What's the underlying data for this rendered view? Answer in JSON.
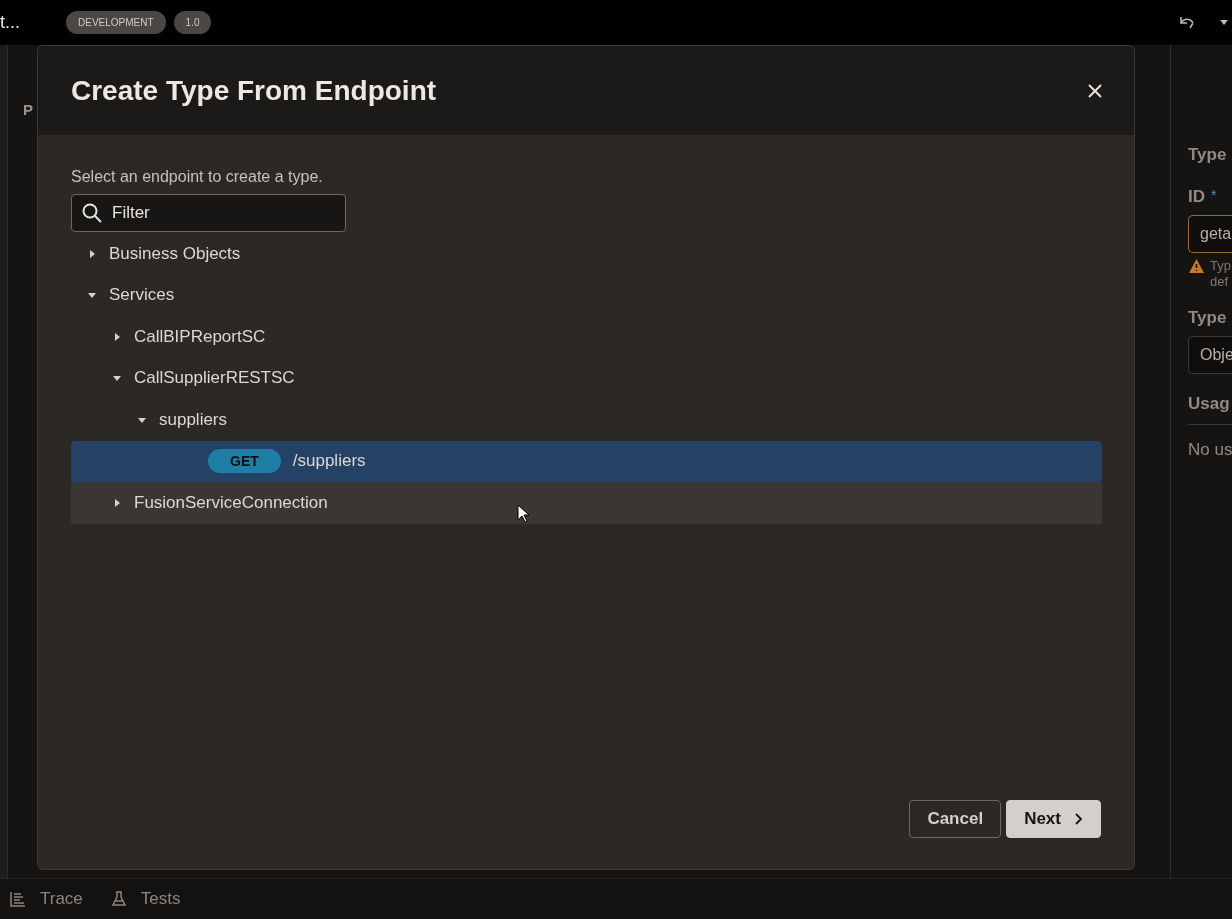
{
  "header": {
    "title": "t...",
    "badges": [
      "DEVELOPMENT",
      "1.0"
    ]
  },
  "left_panel": {
    "heading": "P"
  },
  "right_panel": {
    "heading": "Type",
    "id_label": "ID",
    "required_mark": "*",
    "id_value": "geta",
    "warning_lines": [
      "Typ",
      "def"
    ],
    "type_label": "Type",
    "type_value": "Obje",
    "usages_label": "Usag",
    "usages_text": "No us"
  },
  "dialog": {
    "title": "Create Type From Endpoint",
    "instruction": "Select an endpoint to create a type.",
    "filter": {
      "placeholder": "Filter"
    },
    "tree": [
      {
        "kind": "folder",
        "label": "Business Objects",
        "expanded": false,
        "selected": false,
        "hovered": false
      },
      {
        "kind": "folder",
        "label": "Services",
        "expanded": true,
        "selected": false,
        "hovered": false,
        "children": [
          {
            "kind": "folder",
            "label": "CallBIPReportSC",
            "expanded": false,
            "selected": false,
            "hovered": false
          },
          {
            "kind": "folder",
            "label": "CallSupplierRESTSC",
            "expanded": true,
            "selected": false,
            "hovered": false,
            "children": [
              {
                "kind": "folder",
                "label": "suppliers",
                "expanded": true,
                "selected": false,
                "hovered": false,
                "children": [
                  {
                    "kind": "endpoint",
                    "method": "GET",
                    "label": "/suppliers",
                    "selected": true,
                    "hovered": false
                  }
                ]
              }
            ]
          },
          {
            "kind": "folder",
            "label": "FusionServiceConnection",
            "expanded": false,
            "selected": false,
            "hovered": true
          }
        ]
      }
    ],
    "buttons": [
      {
        "kind": "secondary",
        "label": "Cancel"
      },
      {
        "kind": "primary",
        "label": "Next"
      }
    ]
  },
  "bottom_tabs": [
    {
      "kind": "trace",
      "label": "Trace"
    },
    {
      "kind": "tests",
      "label": "Tests"
    }
  ]
}
